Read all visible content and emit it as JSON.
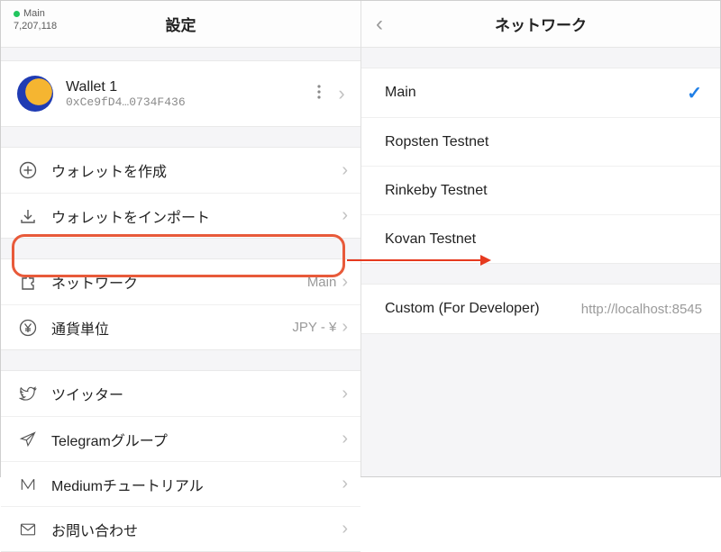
{
  "left": {
    "status": {
      "network": "Main",
      "block": "7,207,118"
    },
    "title": "設定",
    "wallet": {
      "name": "Wallet 1",
      "address": "0xCe9fD4…0734F436"
    },
    "group1": {
      "create": "ウォレットを作成",
      "import": "ウォレットをインポート"
    },
    "group2": {
      "network_label": "ネットワーク",
      "network_value": "Main",
      "currency_label": "通貨単位",
      "currency_value": "JPY - ¥"
    },
    "group3": {
      "twitter": "ツイッター",
      "telegram": "Telegramグループ",
      "medium": "Mediumチュートリアル",
      "contact": "お問い合わせ"
    }
  },
  "right": {
    "title": "ネットワーク",
    "items": {
      "main": "Main",
      "ropsten": "Ropsten Testnet",
      "rinkeby": "Rinkeby Testnet",
      "kovan": "Kovan Testnet"
    },
    "custom": {
      "label": "Custom (For Developer)",
      "value": "http://localhost:8545"
    }
  }
}
